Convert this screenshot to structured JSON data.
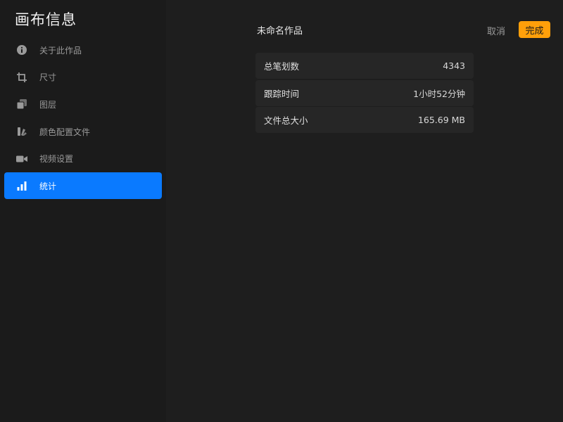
{
  "sidebar": {
    "title": "画布信息",
    "items": [
      {
        "label": "关于此作品",
        "icon": "info-icon",
        "active": false
      },
      {
        "label": "尺寸",
        "icon": "crop-icon",
        "active": false
      },
      {
        "label": "图层",
        "icon": "layers-icon",
        "active": false
      },
      {
        "label": "颜色配置文件",
        "icon": "color-swatch-icon",
        "active": false
      },
      {
        "label": "视频设置",
        "icon": "video-camera-icon",
        "active": false
      },
      {
        "label": "统计",
        "icon": "bar-chart-icon",
        "active": true
      }
    ]
  },
  "header": {
    "title": "未命名作品",
    "cancel_label": "取消",
    "done_label": "完成"
  },
  "stats": [
    {
      "label": "总笔划数",
      "value": "4343"
    },
    {
      "label": "跟踪时间",
      "value": "1小时52分钟"
    },
    {
      "label": "文件总大小",
      "value": "165.69 MB"
    }
  ],
  "colors": {
    "accent_blue": "#0a7aff",
    "accent_orange": "#ff9f0a",
    "background": "#1c1c1c",
    "row_background": "#262626"
  }
}
